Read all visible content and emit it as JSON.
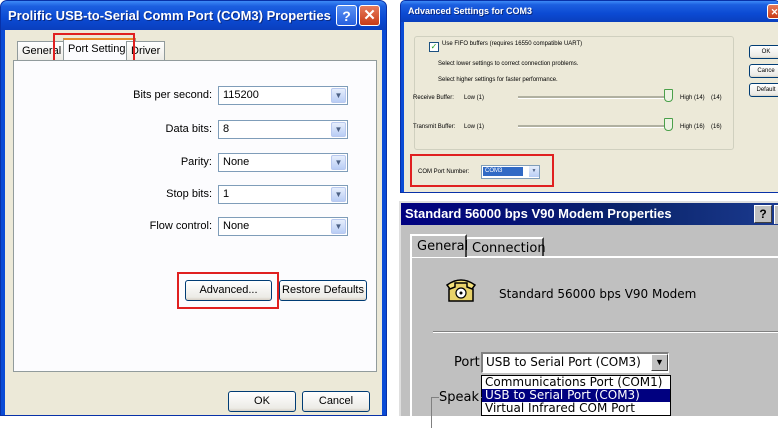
{
  "left_dialog": {
    "title": "Prolific USB-to-Serial Comm Port (COM3) Properties",
    "help": "?",
    "close": "✕",
    "tabs": [
      "General",
      "Port Settings",
      "Driver"
    ],
    "fields": [
      {
        "label": "Bits per second:",
        "value": "115200"
      },
      {
        "label": "Data bits:",
        "value": "8"
      },
      {
        "label": "Parity:",
        "value": "None"
      },
      {
        "label": "Stop bits:",
        "value": "1"
      },
      {
        "label": "Flow control:",
        "value": "None"
      }
    ],
    "advanced_button": "Advanced...",
    "restore_button": "Restore Defaults",
    "ok_button": "OK",
    "cancel_button": "Cancel"
  },
  "advanced_dialog": {
    "title": "Advanced Settings for COM3",
    "fifo_checkbox": "Use FIFO buffers (requires 16550 compatible UART)",
    "fifo_checked": true,
    "hint1": "Select lower settings to correct connection problems.",
    "hint2": "Select higher settings for faster performance.",
    "receive_label": "Receive Buffer:",
    "receive_low": "Low (1)",
    "receive_high": "High (14)",
    "receive_value": "(14)",
    "transmit_label": "Transmit Buffer:",
    "transmit_low": "Low (1)",
    "transmit_high": "High (16)",
    "transmit_value": "(16)",
    "com_port_label": "COM Port Number:",
    "com_port_value": "COM3",
    "ok_button": "OK",
    "cancel_button": "Cance",
    "defaults_button": "Default"
  },
  "modem_dialog": {
    "title": "Standard 56000 bps V90 Modem Properties",
    "help": "?",
    "tabs": [
      "General",
      "Connection"
    ],
    "device_name": "Standard 56000 bps V90 Modem",
    "port_label": "Port:",
    "port_value": "USB to Serial Port (COM3)",
    "dropdown_options": [
      "Communications Port (COM1)",
      "USB to Serial Port (COM3)",
      "Virtual Infrared COM Port"
    ],
    "speaker_label": "Speak"
  },
  "colors": {
    "highlight": "#e02020",
    "xp_blue": "#0a4bd6",
    "selection": "#000080"
  }
}
